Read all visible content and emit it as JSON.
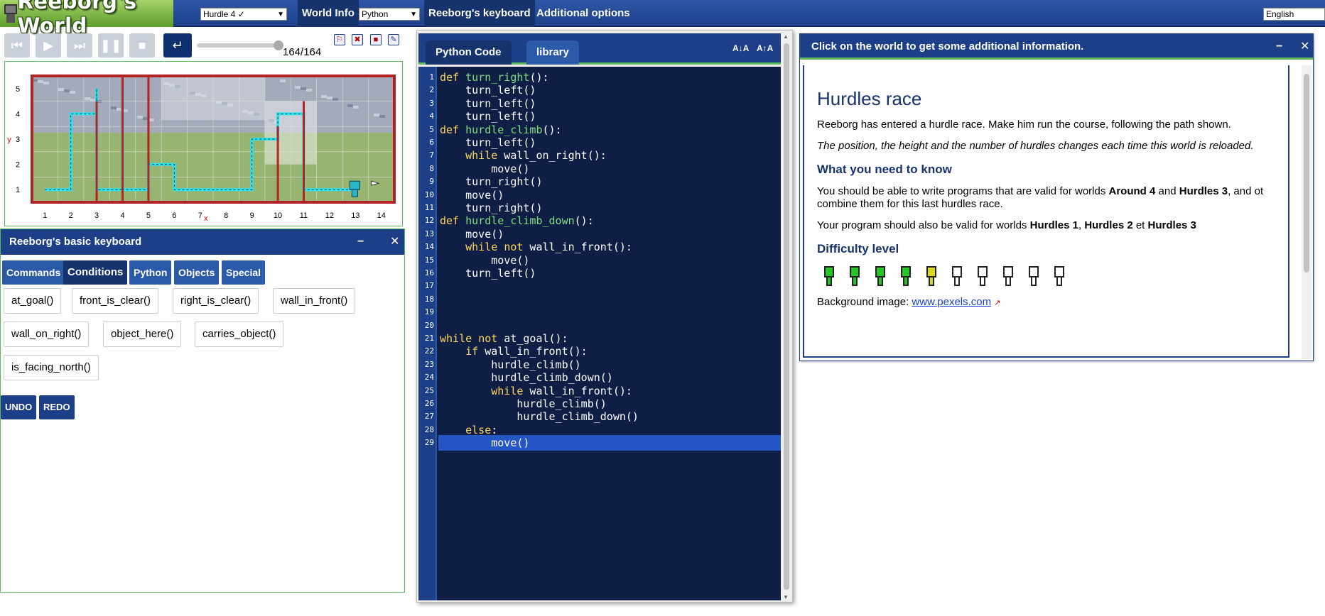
{
  "topbar": {
    "logo_title": "Reeborg's World",
    "world_select": "Hurdle 4 ✓",
    "world_info": "World Info",
    "language_select": "Python",
    "keyboard_button": "Reeborg's keyboard",
    "additional_options": "Additional options",
    "human_language": "English"
  },
  "controls": {
    "step_count": "164/164"
  },
  "world": {
    "x_labels": [
      "1",
      "2",
      "3",
      "4",
      "5",
      "6",
      "7",
      "8",
      "9",
      "10",
      "11",
      "12",
      "13",
      "14"
    ],
    "y_labels": [
      "1",
      "2",
      "3",
      "4",
      "5"
    ],
    "x_axis": "x",
    "y_axis": "y"
  },
  "keyboard": {
    "title": "Reeborg's basic keyboard",
    "tabs": [
      "Commands",
      "Conditions",
      "Python",
      "Objects",
      "Special"
    ],
    "active_tab": "Conditions",
    "keys": [
      "at_goal()",
      "front_is_clear()",
      "right_is_clear()",
      "wall_in_front()",
      "wall_on_right()",
      "object_here()",
      "carries_object()",
      "is_facing_north()"
    ],
    "undo": "UNDO",
    "redo": "REDO"
  },
  "editor": {
    "tab_code": "Python Code",
    "tab_library": "library",
    "sort_a": "A↓A",
    "sort_b": "A↑A",
    "highlighted_line": 29,
    "lines": [
      "def turn_right():",
      "    turn_left()",
      "    turn_left()",
      "    turn_left()",
      "def hurdle_climb():",
      "    turn_left()",
      "    while wall_on_right():",
      "        move()",
      "    turn_right()",
      "    move()",
      "    turn_right()",
      "def hurdle_climb_down():",
      "    move()",
      "    while not wall_in_front():",
      "        move()",
      "    turn_left()",
      "",
      "",
      "",
      "",
      "while not at_goal():",
      "    if wall_in_front():",
      "        hurdle_climb()",
      "        hurdle_climb_down()",
      "        while wall_in_front():",
      "            hurdle_climb()",
      "            hurdle_climb_down()",
      "    else:",
      "        move()"
    ]
  },
  "description": {
    "header": "Click on the world to get some additional information.",
    "title": "Hurdles race",
    "intro": "Reeborg has entered a hurdle race. Make him run the course, following the path shown.",
    "note": "The position, the height and the number of hurdles changes each time this world is reloaded.",
    "need_heading": "What you need to know",
    "need_text_1": "You should be able to write programs that are valid for worlds ",
    "need_bold_1": "Around 4",
    "need_text_2": " and ",
    "need_bold_2": "Hurdles 3",
    "need_text_3": ", and ot combine them for this last hurdles race.",
    "valid_text_1": "Your program should also be valid for worlds ",
    "valid_bold_1": "Hurdles 1",
    "valid_text_2": ", ",
    "valid_bold_2": "Hurdles 2",
    "valid_text_3": " et ",
    "valid_bold_3": "Hurdles 3",
    "difficulty_heading": "Difficulty level",
    "difficulty": 5,
    "difficulty_max": 10,
    "background_label": "Background image: ",
    "background_link": "www.pexels.com"
  },
  "colors": {
    "brand_blue": "#1c3f87",
    "accent_green": "#5cb85c",
    "editor_bg": "#0f1e45",
    "keyword": "#ffd75a",
    "function_name": "#7fe07f",
    "highlight": "#2457c5",
    "path_cyan": "#29e4f0",
    "wall_red": "#b22222"
  }
}
